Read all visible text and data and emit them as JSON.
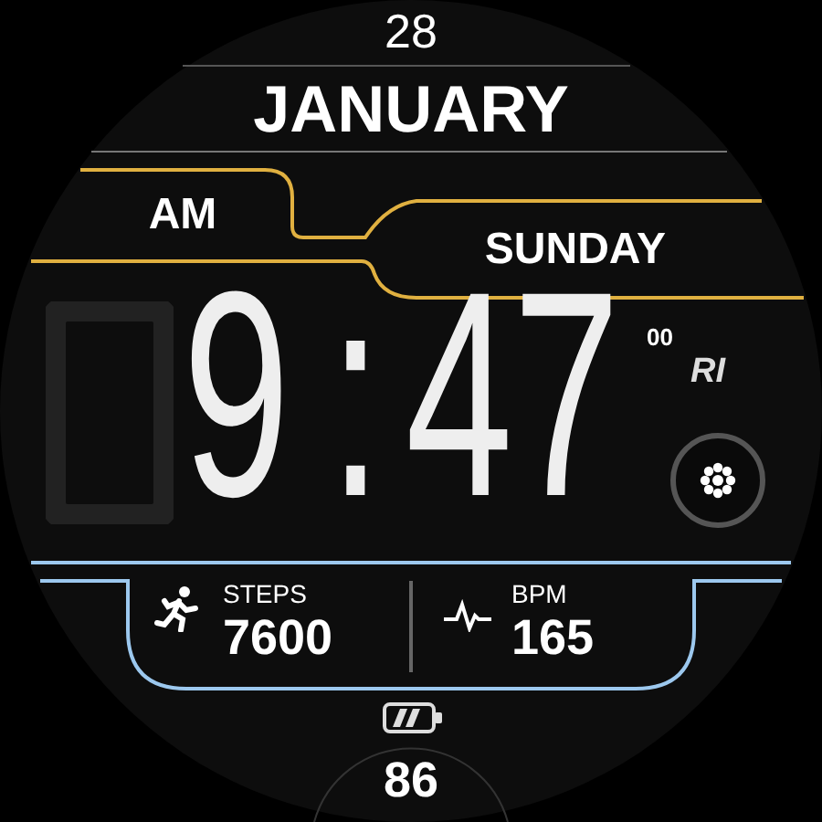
{
  "day": "28",
  "month": "JANUARY",
  "period": "AM",
  "weekday": "SUNDAY",
  "time": {
    "hours": "9",
    "separator": ":",
    "minutes": "47",
    "seconds": "00"
  },
  "logo": "RI",
  "complications": [
    {
      "kind": "steps",
      "label": "STEPS",
      "value": "7600"
    },
    {
      "kind": "heart_rate",
      "label": "BPM",
      "value": "165"
    }
  ],
  "battery": {
    "value": "86"
  }
}
